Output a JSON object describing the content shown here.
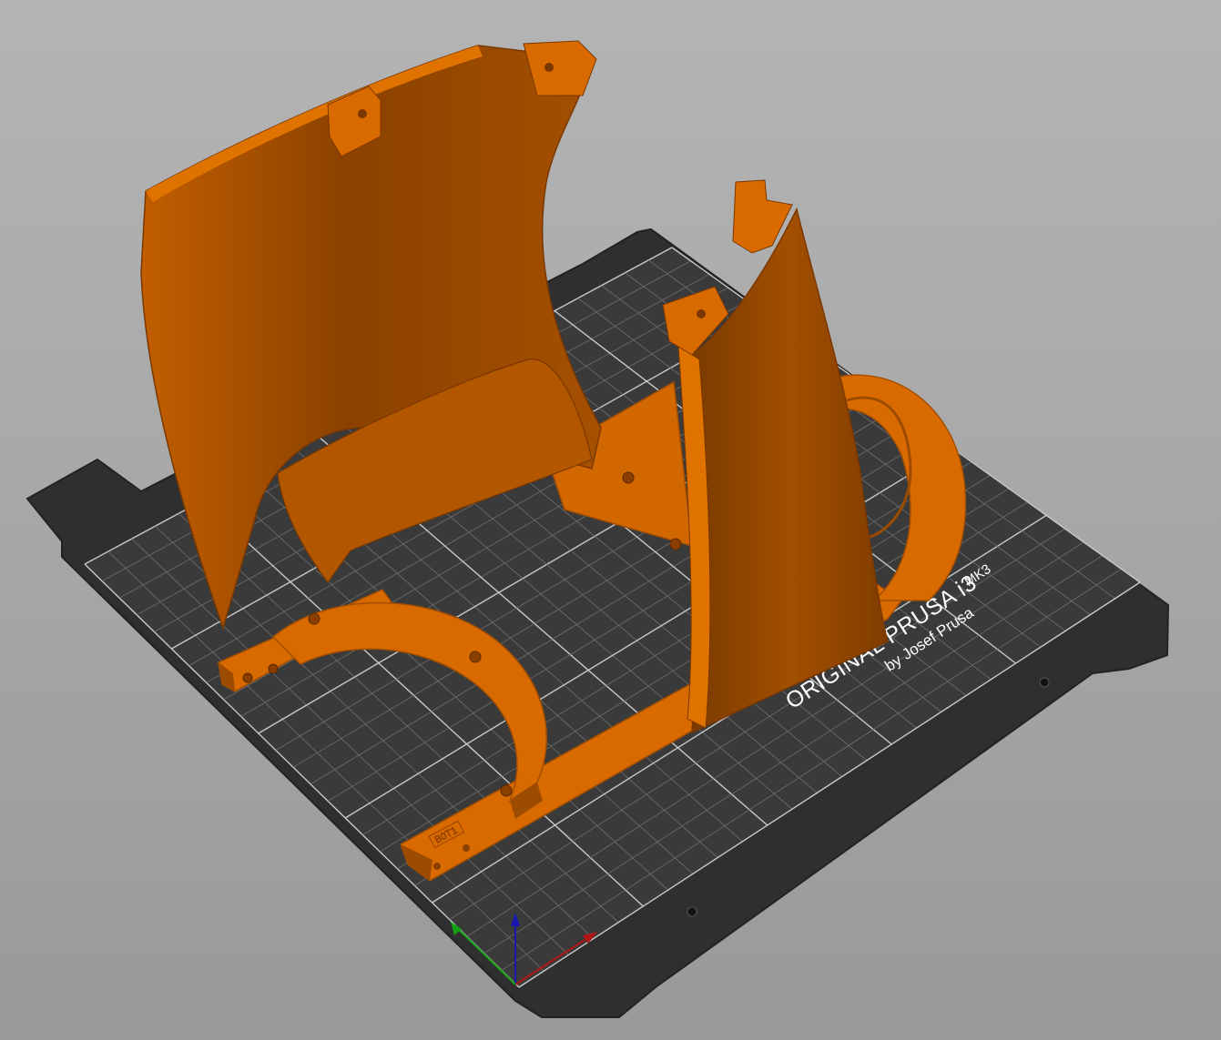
{
  "bed": {
    "brand_line": "ORIGINAL PRUSA i3",
    "model": "MK3",
    "byline": "by Josef Prusa"
  },
  "part": {
    "label": "B0T1"
  },
  "colors": {
    "background": "#a8a8a8",
    "bed": "#2f2f2f",
    "grid": "#9a9a9a",
    "part": "#d96a00",
    "axis_x": "#b01818",
    "axis_y": "#10a010",
    "axis_z": "#1818b0"
  },
  "icons": {
    "axes_gizmo": "xyz-axes-icon"
  }
}
